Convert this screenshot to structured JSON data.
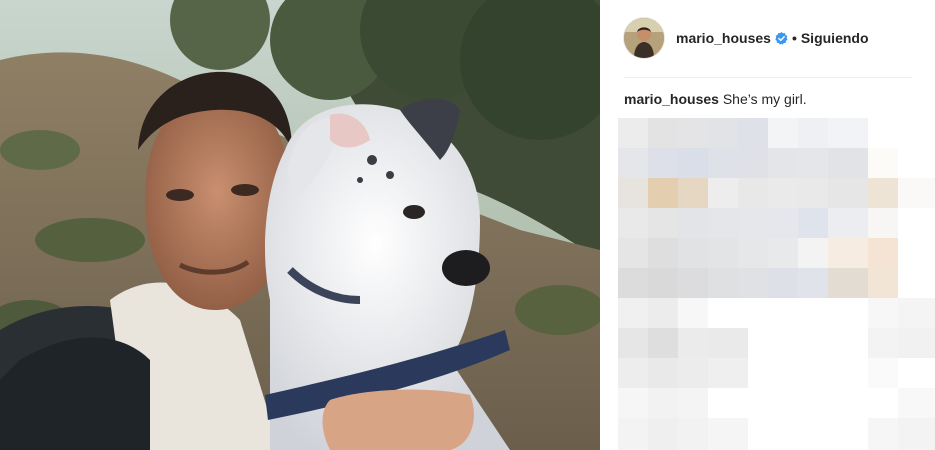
{
  "post": {
    "photo": {
      "alt": "",
      "icon": "selfie-photo"
    },
    "header": {
      "username": "mario_houses",
      "verified_icon": "verified-badge-icon",
      "separator": "•",
      "follow_status": "Siguiendo"
    },
    "caption": {
      "username": "mario_houses",
      "text": "She’s my girl."
    },
    "colors": {
      "verified": "#3897f0",
      "text": "#262626",
      "divider": "#efefef"
    }
  }
}
